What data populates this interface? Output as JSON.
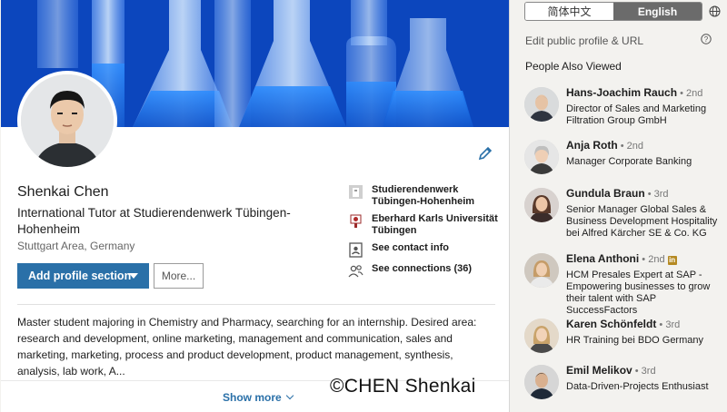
{
  "profile": {
    "name": "Shenkai Chen",
    "headline": "International Tutor at Studierendenwerk Tübingen-Hohenheim",
    "location": "Stuttgart Area, Germany",
    "add_section_label": "Add profile section",
    "more_label": "More...",
    "summary": "Master student majoring in Chemistry and Pharmacy, searching for an internship. Desired area: research and development, online marketing, management and communication, sales and marketing, marketing, process and product development, product management, synthesis, analysis, lab work, A...",
    "show_more_label": "Show more",
    "side_items": [
      {
        "icon": "company-icon",
        "label": "Studierendenwerk Tübingen-Hohenheim"
      },
      {
        "icon": "school-icon",
        "label": "Eberhard Karls Universität Tübingen"
      },
      {
        "icon": "contact-card-icon",
        "label": "See contact info"
      },
      {
        "icon": "connections-icon",
        "label": "See connections (36)"
      }
    ]
  },
  "watermark": "©CHEN Shenkai",
  "right": {
    "lang_options": [
      "简体中文",
      "English"
    ],
    "active_lang": "English",
    "edit_public_label": "Edit public profile & URL",
    "pav_title": "People Also Viewed",
    "people": [
      {
        "name": "Hans-Joachim Rauch",
        "degree": "• 2nd",
        "title": "Director of Sales and Marketing Filtration Group GmbH",
        "premium": false
      },
      {
        "name": "Anja Roth",
        "degree": "• 2nd",
        "title": "Manager Corporate Banking",
        "premium": false
      },
      {
        "name": "Gundula Braun",
        "degree": "• 3rd",
        "title": "Senior Manager Global Sales & Business Development Hospitality bei Alfred Kärcher SE & Co. KG",
        "premium": false
      },
      {
        "name": "Elena Anthoni",
        "degree": "• 2nd",
        "title": "HCM Presales Expert at SAP - Empowering businesses to grow their talent with SAP SuccessFactors",
        "premium": true
      },
      {
        "name": "Karen Schönfeldt",
        "degree": "• 3rd",
        "title": "HR Training bei BDO Germany",
        "premium": false
      },
      {
        "name": "Emil Melikov",
        "degree": "• 3rd",
        "title": "Data-Driven-Projects Enthusiast",
        "premium": false
      }
    ]
  },
  "colors": {
    "accent": "#2a70a8",
    "banner": "#1a66d9",
    "premium": "#b58a23"
  }
}
